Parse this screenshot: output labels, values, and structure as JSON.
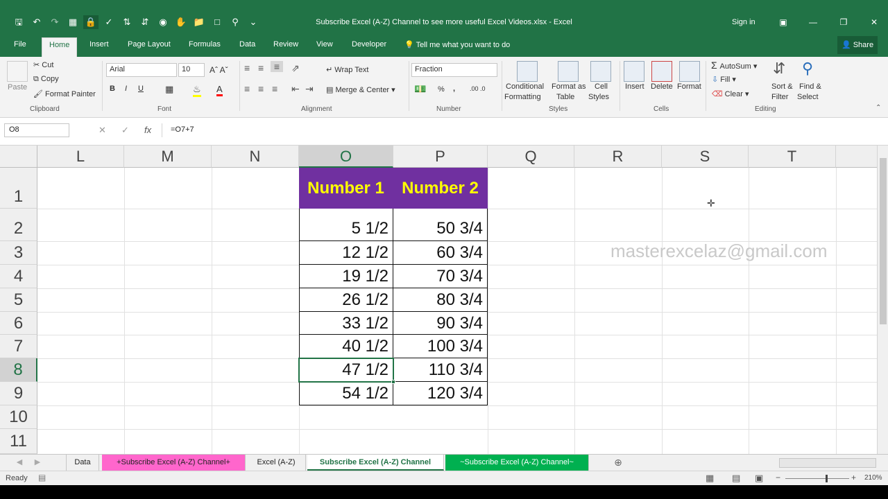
{
  "window": {
    "title": "Subscribe Excel (A-Z) Channel to see more useful Excel Videos.xlsx  -  Excel",
    "sign_in": "Sign in",
    "controls": [
      "restore-ribbon-icon",
      "minimize-icon",
      "restore-icon",
      "close-icon"
    ],
    "qat_icons": [
      "save-icon",
      "undo-icon",
      "redo-icon",
      "table-icon",
      "lock-icon",
      "check-icon",
      "sort-az-icon",
      "sort-za-icon",
      "camera-icon",
      "hand-icon",
      "folder-icon",
      "new-icon",
      "print-preview-icon",
      "customize-icon"
    ]
  },
  "ribbon_tabs": {
    "file": "File",
    "home": "Home",
    "insert": "Insert",
    "page_layout": "Page Layout",
    "formulas": "Formulas",
    "data": "Data",
    "review": "Review",
    "view": "View",
    "developer": "Developer",
    "tell_me": "Tell me what you want to do",
    "share": "Share"
  },
  "clipboard": {
    "paste": "Paste",
    "cut": "Cut",
    "copy": "Copy",
    "format_painter": "Format Painter",
    "label": "Clipboard"
  },
  "font": {
    "name": "Arial",
    "size": "10",
    "bold": "B",
    "italic": "I",
    "underline": "U",
    "label": "Font"
  },
  "alignment": {
    "wrap_text": "Wrap Text",
    "merge_center": "Merge & Center",
    "label": "Alignment"
  },
  "number": {
    "format": "Fraction",
    "percent": "%",
    "comma": ",",
    "label": "Number"
  },
  "styles": {
    "conditional_1": "Conditional",
    "conditional_2": "Formatting",
    "format_as_1": "Format as",
    "format_as_2": "Table",
    "cell_styles_1": "Cell",
    "cell_styles_2": "Styles",
    "label": "Styles"
  },
  "cells": {
    "insert": "Insert",
    "delete": "Delete",
    "format": "Format",
    "label": "Cells"
  },
  "editing": {
    "autosum": "AutoSum",
    "fill": "Fill",
    "clear": "Clear",
    "sort_1": "Sort &",
    "sort_2": "Filter",
    "find_1": "Find &",
    "find_2": "Select",
    "label": "Editing"
  },
  "formula_bar": {
    "name_box": "O8",
    "cancel": "✕",
    "enter": "✓",
    "fx": "fx",
    "formula": "=O7+7"
  },
  "columns": [
    "L",
    "M",
    "N",
    "O",
    "P",
    "Q",
    "R",
    "S",
    "T"
  ],
  "rows": [
    "1",
    "2",
    "3",
    "4",
    "5",
    "6",
    "7",
    "8",
    "9",
    "10",
    "11"
  ],
  "table": {
    "header_o": "Number 1",
    "header_p": "Number 2",
    "number1": [
      "5 1/2",
      "12 1/2",
      "19 1/2",
      "26 1/2",
      "33 1/2",
      "40 1/2",
      "47 1/2",
      "54 1/2"
    ],
    "number2": [
      "50 3/4",
      "60 3/4",
      "70 3/4",
      "80 3/4",
      "90 3/4",
      "100 3/4",
      "110 3/4",
      "120 3/4"
    ]
  },
  "watermark": "masterexcelaz@gmail.com",
  "sheets": {
    "data": "Data",
    "sub1": "+Subscribe Excel (A-Z) Channel+",
    "excel_az": "Excel (A-Z)",
    "sub2": "Subscribe Excel (A-Z) Channel",
    "sub3": "~Subscribe Excel (A-Z) Channel~"
  },
  "status": {
    "ready": "Ready",
    "zoom": "210%"
  },
  "colors": {
    "excel_green": "#217346",
    "header_fill": "#7030a0",
    "header_text": "#ffff00",
    "tab_pink": "#ff66cc",
    "tab_green": "#00b050"
  }
}
